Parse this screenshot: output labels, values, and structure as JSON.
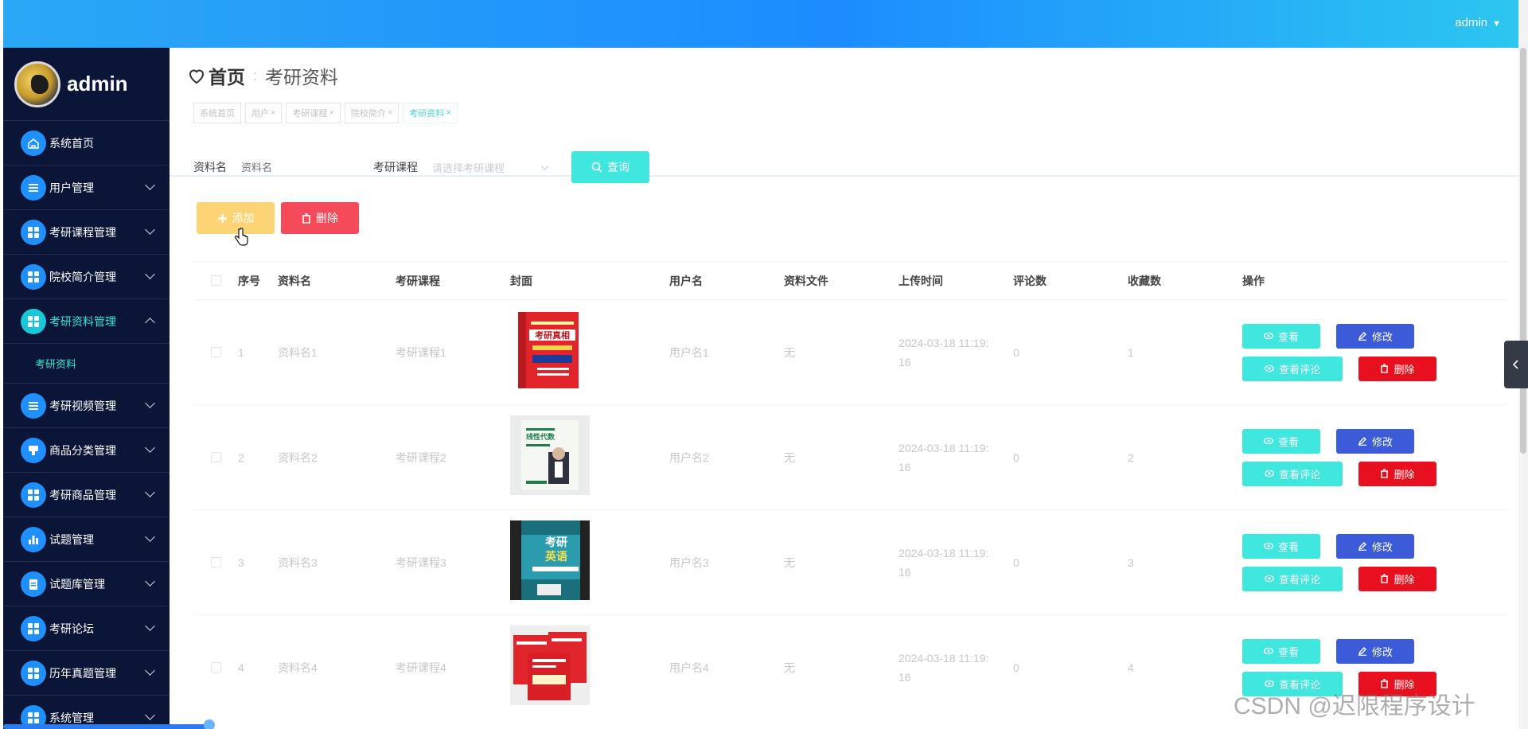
{
  "topbar": {
    "user": "admin"
  },
  "sidebar": {
    "brand": "admin",
    "items": [
      {
        "label": "系统首页",
        "icon": "home-icon",
        "has_children": false,
        "open": false
      },
      {
        "label": "用户管理",
        "icon": "list-icon",
        "has_children": true,
        "open": false
      },
      {
        "label": "考研课程管理",
        "icon": "grid-icon",
        "has_children": true,
        "open": false
      },
      {
        "label": "院校简介管理",
        "icon": "grid-icon",
        "has_children": true,
        "open": false
      },
      {
        "label": "考研资料管理",
        "icon": "grid-icon",
        "has_children": true,
        "open": true
      },
      {
        "label": "考研视频管理",
        "icon": "list-icon",
        "has_children": true,
        "open": false
      },
      {
        "label": "商品分类管理",
        "icon": "tag-icon",
        "has_children": true,
        "open": false
      },
      {
        "label": "考研商品管理",
        "icon": "grid-icon",
        "has_children": true,
        "open": false
      },
      {
        "label": "试题管理",
        "icon": "bar-chart-icon",
        "has_children": true,
        "open": false
      },
      {
        "label": "试题库管理",
        "icon": "clipboard-icon",
        "has_children": true,
        "open": false
      },
      {
        "label": "考研论坛",
        "icon": "grid-icon",
        "has_children": true,
        "open": false
      },
      {
        "label": "历年真题管理",
        "icon": "grid-icon",
        "has_children": true,
        "open": false
      },
      {
        "label": "系统管理",
        "icon": "grid-icon",
        "has_children": true,
        "open": false
      }
    ],
    "subitem": "考研资料"
  },
  "breadcrumb": {
    "home": "首页",
    "current": "考研资料"
  },
  "tags": [
    {
      "label": "系统首页",
      "closable": false,
      "active": false
    },
    {
      "label": "用户",
      "closable": true,
      "active": false
    },
    {
      "label": "考研课程",
      "closable": true,
      "active": false
    },
    {
      "label": "院校简介",
      "closable": true,
      "active": false
    },
    {
      "label": "考研资料",
      "closable": true,
      "active": true
    }
  ],
  "search": {
    "name_label": "资料名",
    "name_placeholder": "资料名",
    "course_label": "考研课程",
    "course_placeholder": "请选择考研课程",
    "search_button": "查询"
  },
  "actions": {
    "add": "添加",
    "delete": "删除"
  },
  "table": {
    "headers": [
      "序号",
      "资料名",
      "考研课程",
      "封面",
      "用户名",
      "资料文件",
      "上传时间",
      "评论数",
      "收藏数",
      "操作"
    ],
    "ops": {
      "view": "查看",
      "edit": "修改",
      "comments": "查看评论",
      "delete": "删除"
    },
    "rows": [
      {
        "idx": "1",
        "name": "资料名1",
        "course": "考研课程1",
        "user": "用户名1",
        "file": "无",
        "time1": "2024-03-18 11:19:",
        "time2": "16",
        "comments": "0",
        "favorites": "1"
      },
      {
        "idx": "2",
        "name": "资料名2",
        "course": "考研课程2",
        "user": "用户名2",
        "file": "无",
        "time1": "2024-03-18 11:19:",
        "time2": "16",
        "comments": "0",
        "favorites": "2"
      },
      {
        "idx": "3",
        "name": "资料名3",
        "course": "考研课程3",
        "user": "用户名3",
        "file": "无",
        "time1": "2024-03-18 11:19:",
        "time2": "16",
        "comments": "0",
        "favorites": "3"
      },
      {
        "idx": "4",
        "name": "资料名4",
        "course": "考研课程4",
        "user": "用户名4",
        "file": "无",
        "time1": "2024-03-18 11:19:",
        "time2": "16",
        "comments": "0",
        "favorites": "4"
      }
    ]
  },
  "watermark": "CSDN @迟限程序设计",
  "colors": {
    "accent": "#3fe7df",
    "primary": "#1c8cff",
    "danger": "#e8101e",
    "sidebar": "#0b1537"
  }
}
